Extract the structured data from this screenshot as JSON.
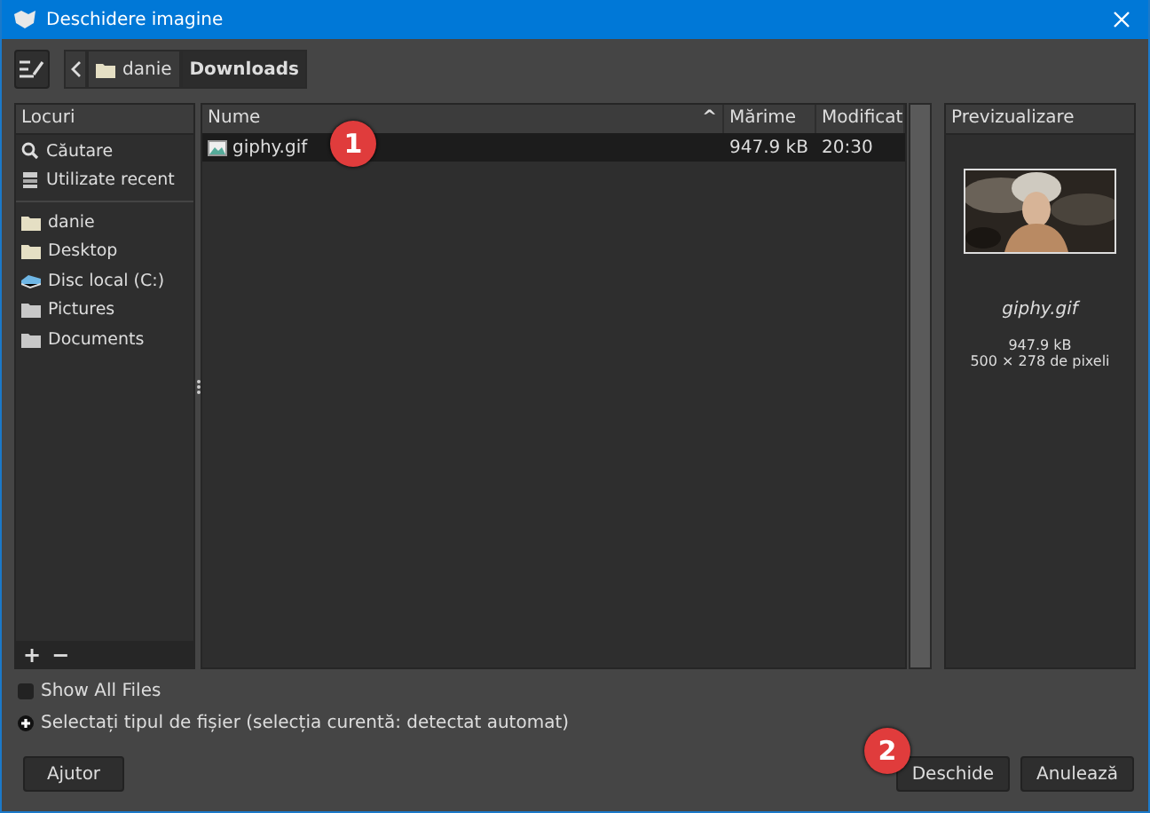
{
  "window": {
    "title": "Deschidere imagine"
  },
  "path_bar": {
    "segments": [
      {
        "label": "danie",
        "kind": "folder",
        "selected": false
      },
      {
        "label": "Downloads",
        "kind": "plain",
        "selected": true
      }
    ]
  },
  "places": {
    "header": "Locuri",
    "groups": [
      [
        {
          "label": "Căutare",
          "kind": "search"
        },
        {
          "label": "Utilizate recent",
          "kind": "recent"
        }
      ],
      [
        {
          "label": "danie",
          "kind": "home"
        },
        {
          "label": "Desktop",
          "kind": "home"
        },
        {
          "label": "Disc local (C:)",
          "kind": "drive"
        },
        {
          "label": "Pictures",
          "kind": "folder"
        },
        {
          "label": "Documents",
          "kind": "folder"
        }
      ]
    ],
    "add": "+",
    "remove": "−"
  },
  "files": {
    "columns": [
      "Nume",
      "Mărime",
      "Modificat"
    ],
    "sort_arrow": "^",
    "rows": [
      {
        "name": "giphy.gif",
        "size": "947.9 kB",
        "modified": "20:30",
        "selected": true
      }
    ]
  },
  "preview": {
    "header": "Previzualizare",
    "name": "giphy.gif",
    "size": "947.9 kB",
    "dimensions": "500 × 278 de pixeli"
  },
  "show_all_files": {
    "label": "Show All Files",
    "checked": false
  },
  "file_type": {
    "label": "Selectați tipul de fișier (selecția curentă: detectat automat)",
    "expanded": false
  },
  "buttons": {
    "help": "Ajutor",
    "open": "Deschide",
    "cancel": "Anulează"
  },
  "annotations": [
    {
      "label": "1"
    },
    {
      "label": "2"
    }
  ]
}
